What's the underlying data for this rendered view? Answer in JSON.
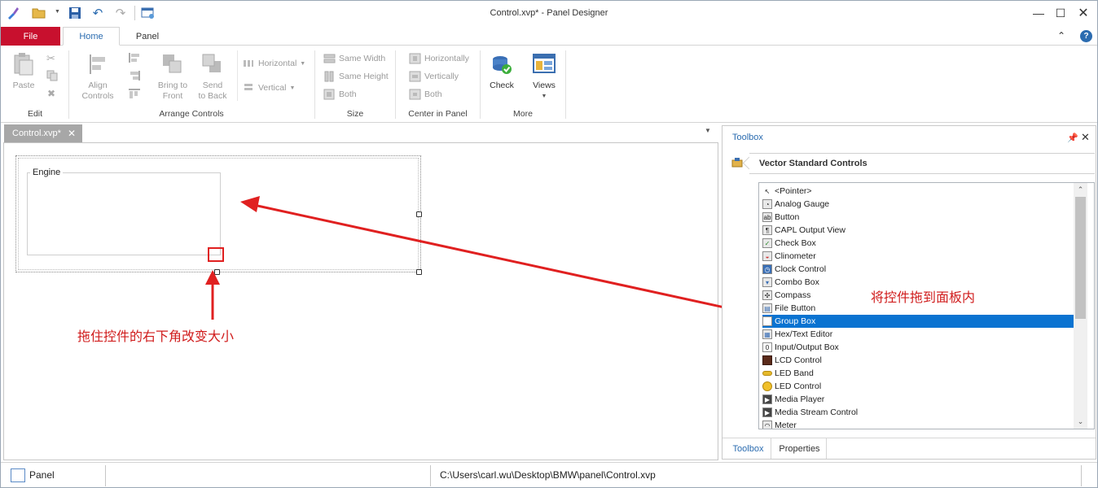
{
  "window": {
    "title": "Control.xvp* - Panel Designer"
  },
  "ribbon": {
    "file_tab": "File",
    "tabs": [
      "Home",
      "Panel"
    ],
    "edit": {
      "paste": "Paste",
      "label": "Edit"
    },
    "arrange": {
      "align": "Align Controls",
      "bring_front": "Bring to Front",
      "send_back": "Send to Back",
      "horizontal": "Horizontal",
      "vertical": "Vertical",
      "label": "Arrange Controls"
    },
    "size": {
      "same_width": "Same Width",
      "same_height": "Same Height",
      "both": "Both",
      "label": "Size"
    },
    "center": {
      "horizontally": "Horizontally",
      "vertically": "Vertically",
      "both": "Both",
      "label": "Center in Panel"
    },
    "more": {
      "check": "Check",
      "views": "Views",
      "label": "More"
    }
  },
  "document": {
    "tab_label": "Control.xvp*",
    "groupbox_label": "Engine"
  },
  "annotations": {
    "resize_hint": "拖住控件的右下角改变大小",
    "drag_hint": "将控件拖到面板内"
  },
  "toolbox": {
    "title": "Toolbox",
    "category": "Vector Standard Controls",
    "items": [
      "<Pointer>",
      "Analog Gauge",
      "Button",
      "CAPL Output View",
      "Check Box",
      "Clinometer",
      "Clock Control",
      "Combo Box",
      "Compass",
      "File Button",
      "Group Box",
      "Hex/Text Editor",
      "Input/Output Box",
      "LCD Control",
      "LED Band",
      "LED Control",
      "Media Player",
      "Media Stream Control",
      "Meter"
    ],
    "selected_item": "Group Box",
    "bottom_tabs": [
      "Toolbox",
      "Properties"
    ]
  },
  "status": {
    "panel": "Panel",
    "path": "C:\\Users\\carl.wu\\Desktop\\BMW\\panel\\Control.xvp"
  },
  "colors": {
    "file_tab": "#c8102e",
    "accent": "#2b6cb0",
    "selection": "#0a73d1",
    "annotation": "#d01c1c"
  }
}
